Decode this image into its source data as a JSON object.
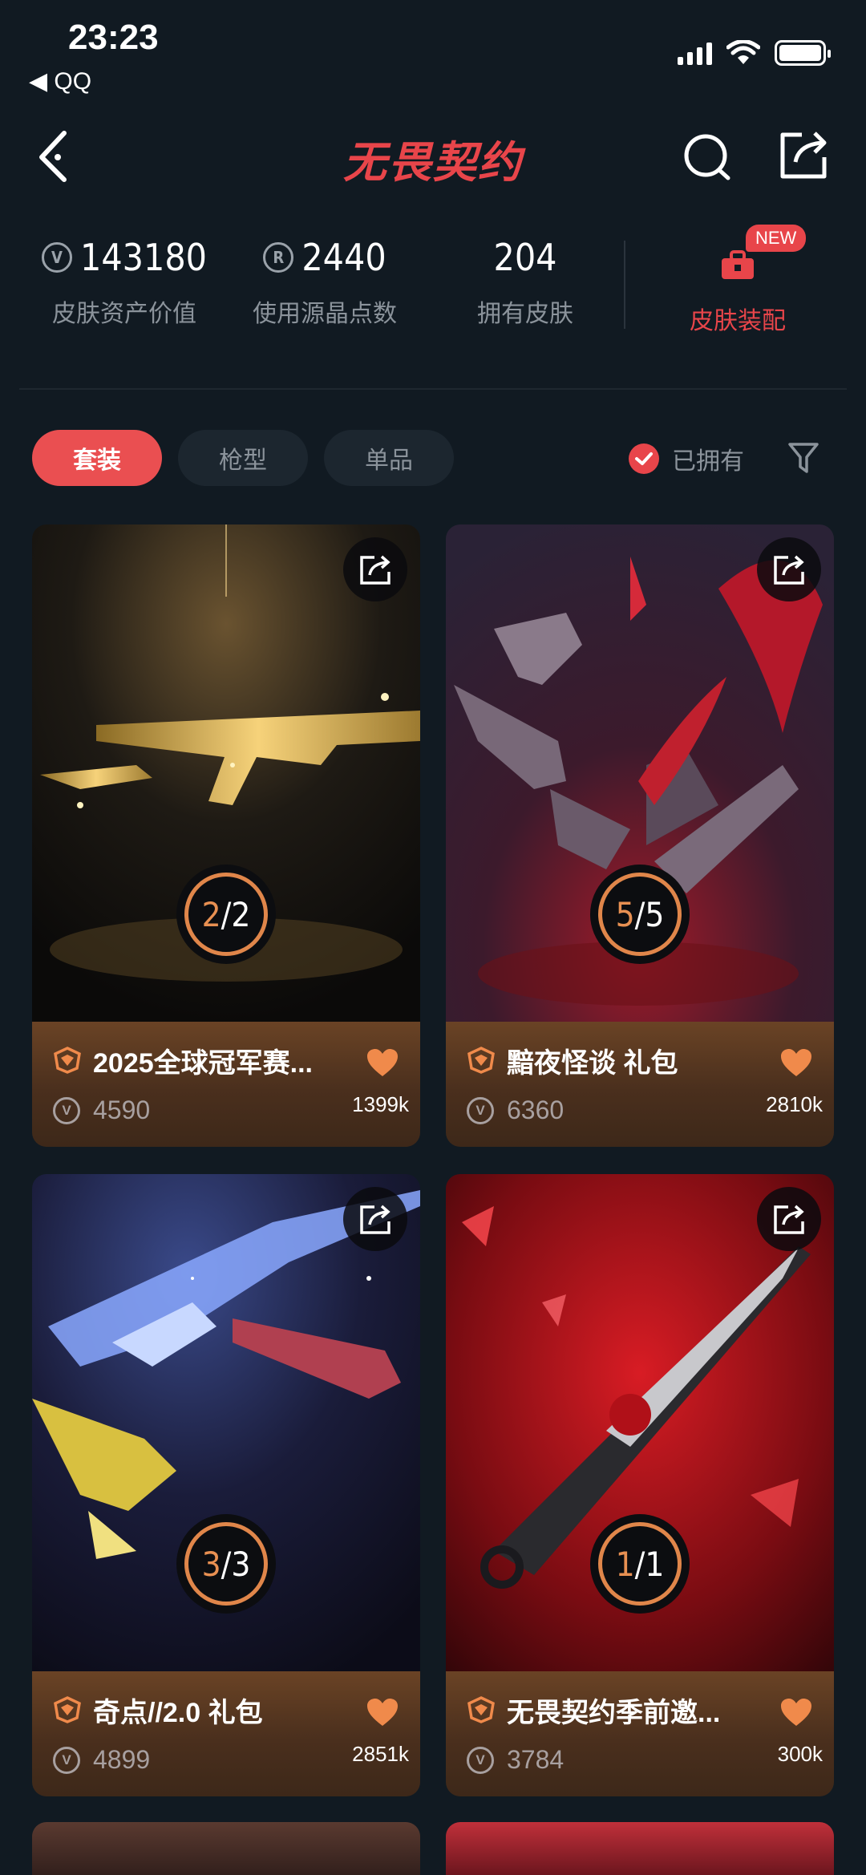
{
  "status_bar": {
    "time": "23:23",
    "back_app": "◀ QQ"
  },
  "nav": {
    "logo_text": "无畏契约"
  },
  "stats": {
    "asset_value": "143180",
    "asset_value_label": "皮肤资产价值",
    "points_used": "2440",
    "points_used_label": "使用源晶点数",
    "skins_owned": "204",
    "skins_owned_label": "拥有皮肤",
    "equip_label": "皮肤装配",
    "new_badge": "NEW"
  },
  "filters": {
    "tabs": [
      "套装",
      "枪型",
      "单品"
    ],
    "active_tab": "套装",
    "owned_label": "已拥有",
    "owned_checked": true
  },
  "cards": [
    {
      "title": "2025全球冠军赛...",
      "owned": "2",
      "total": "2",
      "price": "4590",
      "likes": "1399k",
      "theme": "gold"
    },
    {
      "title": "黯夜怪谈 礼包",
      "owned": "5",
      "total": "5",
      "price": "6360",
      "likes": "2810k",
      "theme": "crimson"
    },
    {
      "title": "奇点//2.0 礼包",
      "owned": "3",
      "total": "3",
      "price": "4899",
      "likes": "2851k",
      "theme": "blue"
    },
    {
      "title": "无畏契约季前邀...",
      "owned": "1",
      "total": "1",
      "price": "3784",
      "likes": "300k",
      "theme": "red"
    }
  ],
  "colors": {
    "accent": "#e8454a",
    "background": "#111a22",
    "progress_ring": "#e0864a",
    "heart": "#f08a4b"
  }
}
